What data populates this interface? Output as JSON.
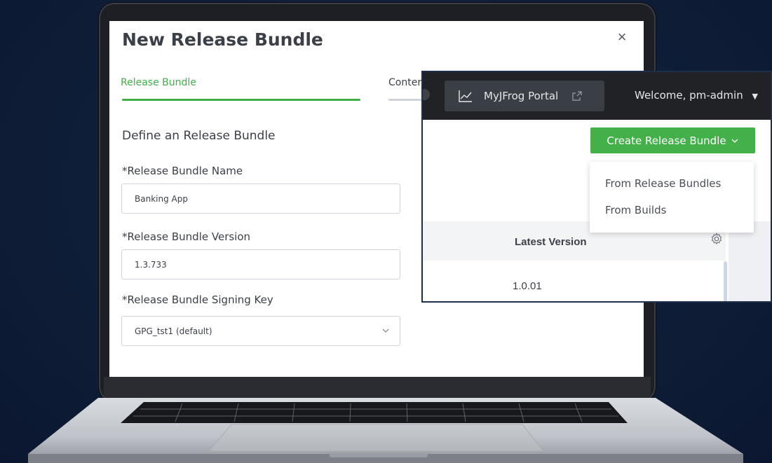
{
  "modal": {
    "title": "New Release Bundle",
    "close": "×",
    "tabs": [
      {
        "label": "Release Bundle",
        "active": true
      },
      {
        "label": "Conter",
        "active": false
      }
    ],
    "section_title": "Define an Release Bundle",
    "fields": [
      {
        "label": "*Release Bundle Name",
        "value": "Banking App"
      },
      {
        "label": "*Release Bundle Version",
        "value": "1.3.733"
      },
      {
        "label": "*Release Bundle Signing Key",
        "value": "GPG_tst1 (default)"
      }
    ]
  },
  "overlay": {
    "topbar": {
      "portal_label": "MyJFrog Portal",
      "welcome": "Welcome, pm-admin"
    },
    "create_button": "Create Release Bundle",
    "dropdown": [
      "From Release Bundles",
      "From Builds"
    ],
    "table": {
      "column": "Latest Version",
      "rows": [
        "1.0.01"
      ]
    }
  },
  "colors": {
    "accent_green": "#43b049",
    "topbar": "#202225",
    "background": "#0f1e38"
  },
  "icons": [
    "close-icon",
    "chart-icon",
    "external-link-icon",
    "caret-down-icon",
    "chevron-down-icon",
    "gear-icon"
  ]
}
